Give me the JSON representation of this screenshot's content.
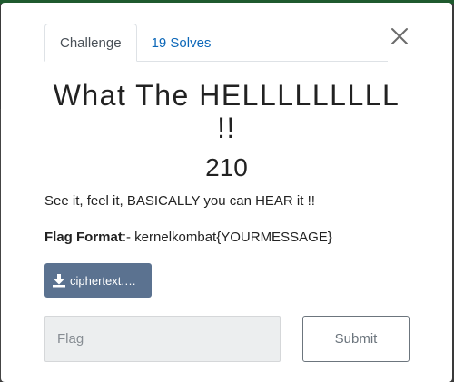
{
  "modal": {
    "tabs": [
      {
        "label": "Challenge"
      },
      {
        "label": "19 Solves"
      }
    ],
    "title_line1": "What The HELLLLLLLLL",
    "title_line2": "!!",
    "value": "210",
    "description": "See it, feel it, BASICALLY you can HEAR it !!",
    "flag_format_label": "Flag Format",
    "flag_format_value": ":- kernelkombat{YOURMESSAGE}",
    "file_button": "ciphertext.…",
    "flag_input": {
      "placeholder": "Flag",
      "value": ""
    },
    "submit_label": "Submit"
  },
  "icons": {
    "close": "close-icon",
    "download": "download-icon"
  },
  "colors": {
    "link": "#0c67b8",
    "file_button_bg": "#5b7290",
    "input_bg": "#eceeef",
    "submit_border": "#6c757d"
  }
}
